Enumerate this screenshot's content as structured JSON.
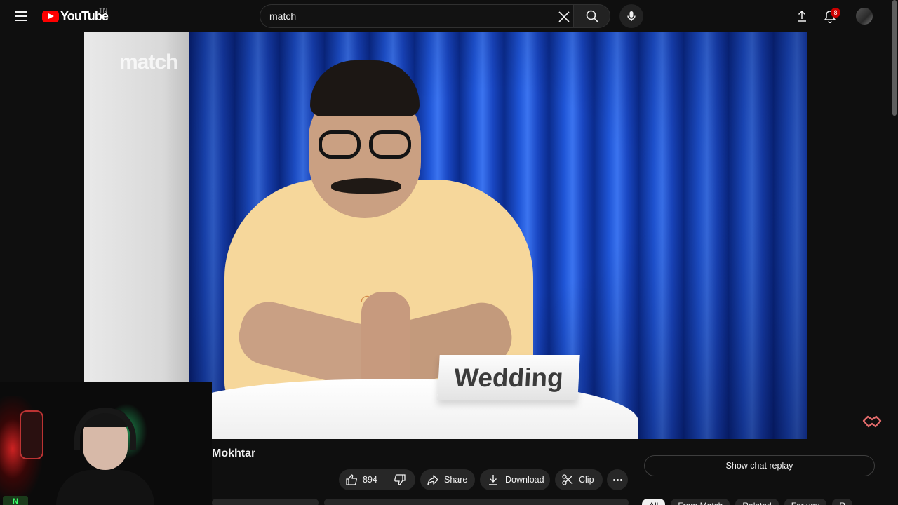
{
  "masthead": {
    "logo_text": "YouTube",
    "country_code": "TN",
    "search_value": "match",
    "notification_count": "8"
  },
  "player": {
    "watermark": "match",
    "placard_text": "Wedding",
    "facecam_logo": "N"
  },
  "video": {
    "title_visible": "Mokhtar"
  },
  "actions": {
    "like_count": "894",
    "share_label": "Share",
    "download_label": "Download",
    "clip_label": "Clip"
  },
  "chat": {
    "replay_label": "Show chat replay"
  },
  "chips": [
    {
      "label": "All"
    },
    {
      "label": "From Match"
    },
    {
      "label": "Related"
    },
    {
      "label": "For you"
    },
    {
      "label": "R"
    }
  ]
}
